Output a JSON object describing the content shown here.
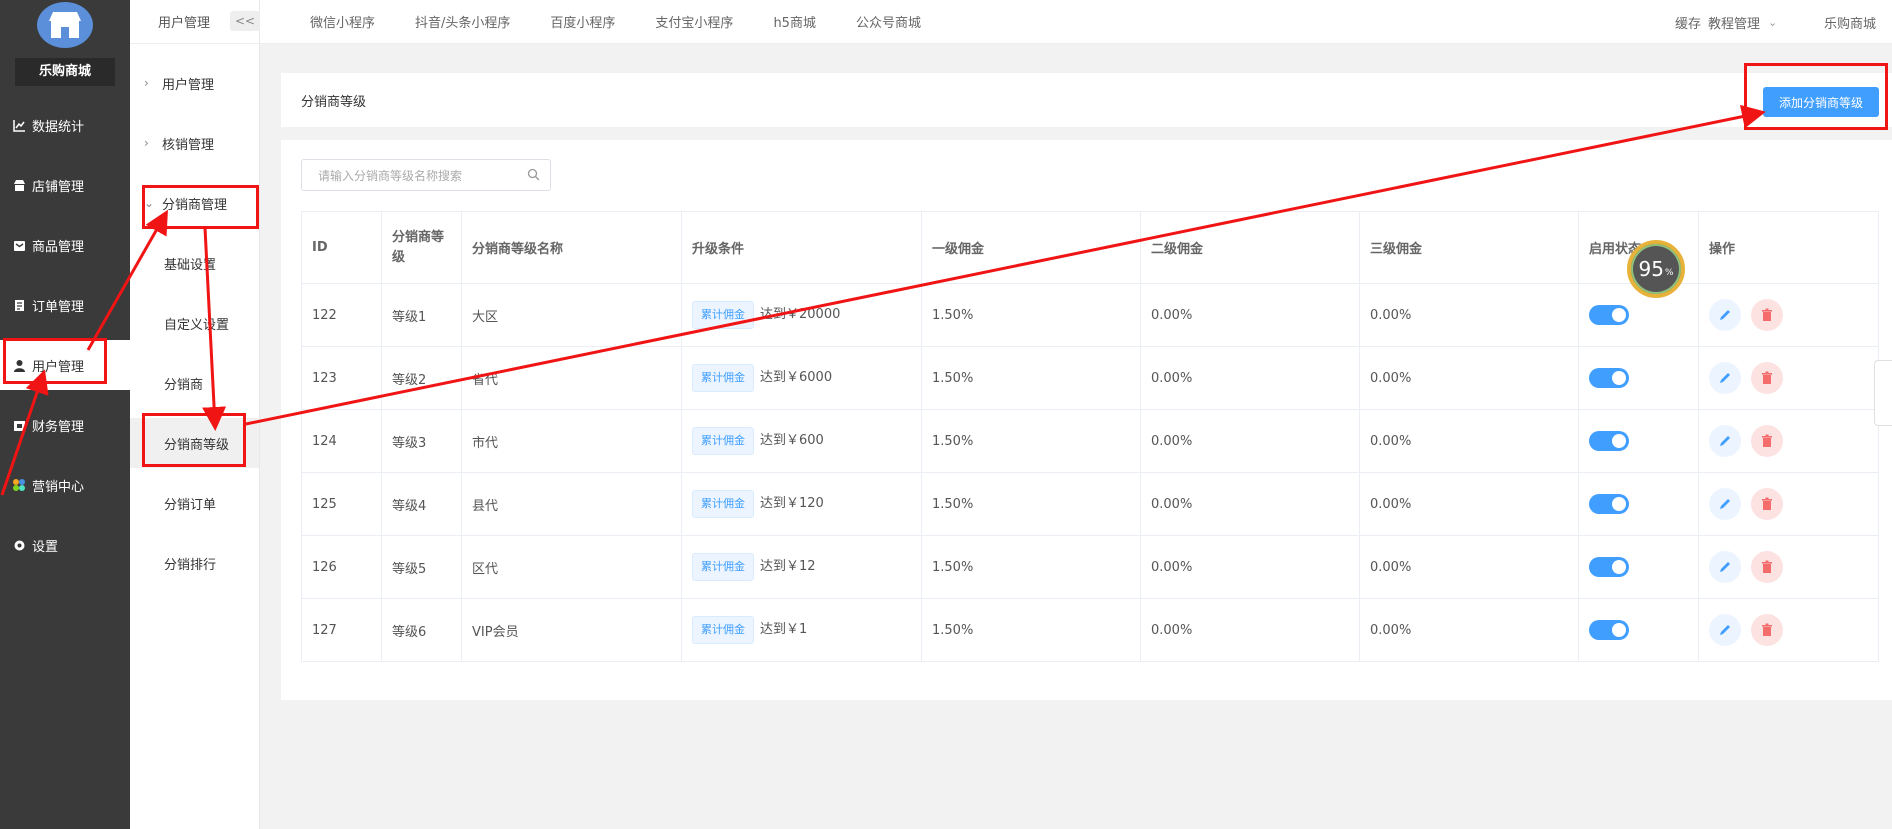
{
  "sidebar": {
    "shop_name": "乐购商城",
    "items": [
      {
        "label": "数据统计",
        "icon": "chart-icon"
      },
      {
        "label": "店铺管理",
        "icon": "store-icon"
      },
      {
        "label": "商品管理",
        "icon": "goods-icon"
      },
      {
        "label": "订单管理",
        "icon": "order-icon"
      },
      {
        "label": "用户管理",
        "icon": "user-icon"
      },
      {
        "label": "财务管理",
        "icon": "finance-icon"
      },
      {
        "label": "营销中心",
        "icon": "marketing-icon"
      },
      {
        "label": "设置",
        "icon": "gear-icon"
      }
    ]
  },
  "subnav": {
    "title": "用户管理",
    "collapse": "<<",
    "items": [
      {
        "label": "用户管理"
      },
      {
        "label": "核销管理"
      },
      {
        "label": "分销商管理"
      },
      {
        "label": "基础设置"
      },
      {
        "label": "自定义设置"
      },
      {
        "label": "分销商"
      },
      {
        "label": "分销商等级"
      },
      {
        "label": "分销订单"
      },
      {
        "label": "分销排行"
      }
    ]
  },
  "topbar": {
    "tabs": [
      "微信小程序",
      "抖音/头条小程序",
      "百度小程序",
      "支付宝小程序",
      "h5商城",
      "公众号商城"
    ],
    "cache": "缓存",
    "tutorial": "教程管理",
    "shop": "乐购商城"
  },
  "page": {
    "title": "分销商等级",
    "add_button": "添加分销商等级",
    "search_placeholder": "请输入分销商等级名称搜索"
  },
  "table": {
    "headers": [
      "ID",
      "分销商等级",
      "分销商等级名称",
      "升级条件",
      "一级佣金",
      "二级佣金",
      "三级佣金",
      "启用状态",
      "操作"
    ],
    "condition_tag": "累计佣金",
    "rows": [
      {
        "id": "122",
        "level": "等级1",
        "name": "大区",
        "cond": "达到￥20000",
        "c1": "1.50%",
        "c2": "0.00%",
        "c3": "0.00%"
      },
      {
        "id": "123",
        "level": "等级2",
        "name": "省代",
        "cond": "达到￥6000",
        "c1": "1.50%",
        "c2": "0.00%",
        "c3": "0.00%"
      },
      {
        "id": "124",
        "level": "等级3",
        "name": "市代",
        "cond": "达到￥600",
        "c1": "1.50%",
        "c2": "0.00%",
        "c3": "0.00%"
      },
      {
        "id": "125",
        "level": "等级4",
        "name": "县代",
        "cond": "达到￥120",
        "c1": "1.50%",
        "c2": "0.00%",
        "c3": "0.00%"
      },
      {
        "id": "126",
        "level": "等级5",
        "name": "区代",
        "cond": "达到￥12",
        "c1": "1.50%",
        "c2": "0.00%",
        "c3": "0.00%"
      },
      {
        "id": "127",
        "level": "等级6",
        "name": "VIP会员",
        "cond": "达到￥1",
        "c1": "1.50%",
        "c2": "0.00%",
        "c3": "0.00%"
      }
    ]
  },
  "badge": {
    "value": "95",
    "unit": "%"
  },
  "colors": {
    "accent": "#409eff",
    "sidebar": "#3a3a3a",
    "annotation": "#f01414",
    "delete": "#f56c6c"
  }
}
